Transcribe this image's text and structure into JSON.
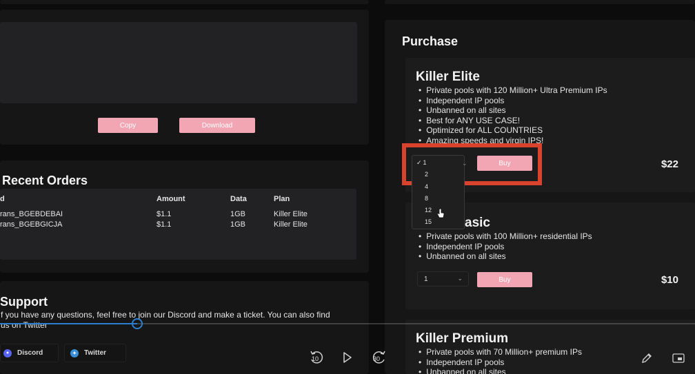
{
  "colors": {
    "accent": "#f2a6b4",
    "highlight_box": "#d9422c",
    "progress": "#2b7fd0"
  },
  "left": {
    "copy_label": "Copy",
    "download_label": "Download",
    "orders": {
      "title": "Recent Orders",
      "headers": [
        "d",
        "Amount",
        "Data",
        "Plan"
      ],
      "rows": [
        [
          "rans_BGEBDEBAI",
          "$1.1",
          "1GB",
          "Killer Elite"
        ],
        [
          "rans_BGEBGICJA",
          "$1.1",
          "1GB",
          "Killer Elite"
        ]
      ]
    },
    "support": {
      "title": "Support",
      "line1": "f you have any questions, feel free to join our Discord and make a ticket. You can also find",
      "line2": "us on Twitter",
      "discord_label": "Discord",
      "twitter_label": "Twitter"
    }
  },
  "purchase": {
    "title": "Purchase",
    "buy_label": "Buy",
    "plans": [
      {
        "name": "Killer Elite",
        "features": [
          "Private pools with 120 Million+ Ultra Premium IPs",
          "Independent IP pools",
          "Unbanned on all sites",
          "Best for ANY USE CASE!",
          "Optimized for ALL COUNTRIES",
          "Amazing speeds and virgin IPS!"
        ],
        "price": "$22"
      },
      {
        "name": "asic",
        "features": [
          "Private pools with 100 Million+ residential IPs",
          "Independent IP pools",
          "Unbanned on all sites"
        ],
        "price": "$10",
        "quantity": "1"
      },
      {
        "name": "Killer Premium",
        "features": [
          "Private pools with 70 Million+ premium IPs",
          "Independent IP pools",
          "Unbanned on all sites"
        ]
      }
    ],
    "dropdown": {
      "options": [
        "1",
        "2",
        "4",
        "8",
        "12",
        "15"
      ],
      "selected": "1",
      "check_glyph": "✓"
    }
  },
  "player": {
    "rewind_label": "10",
    "forward_label": "30",
    "progress": 0.197
  }
}
